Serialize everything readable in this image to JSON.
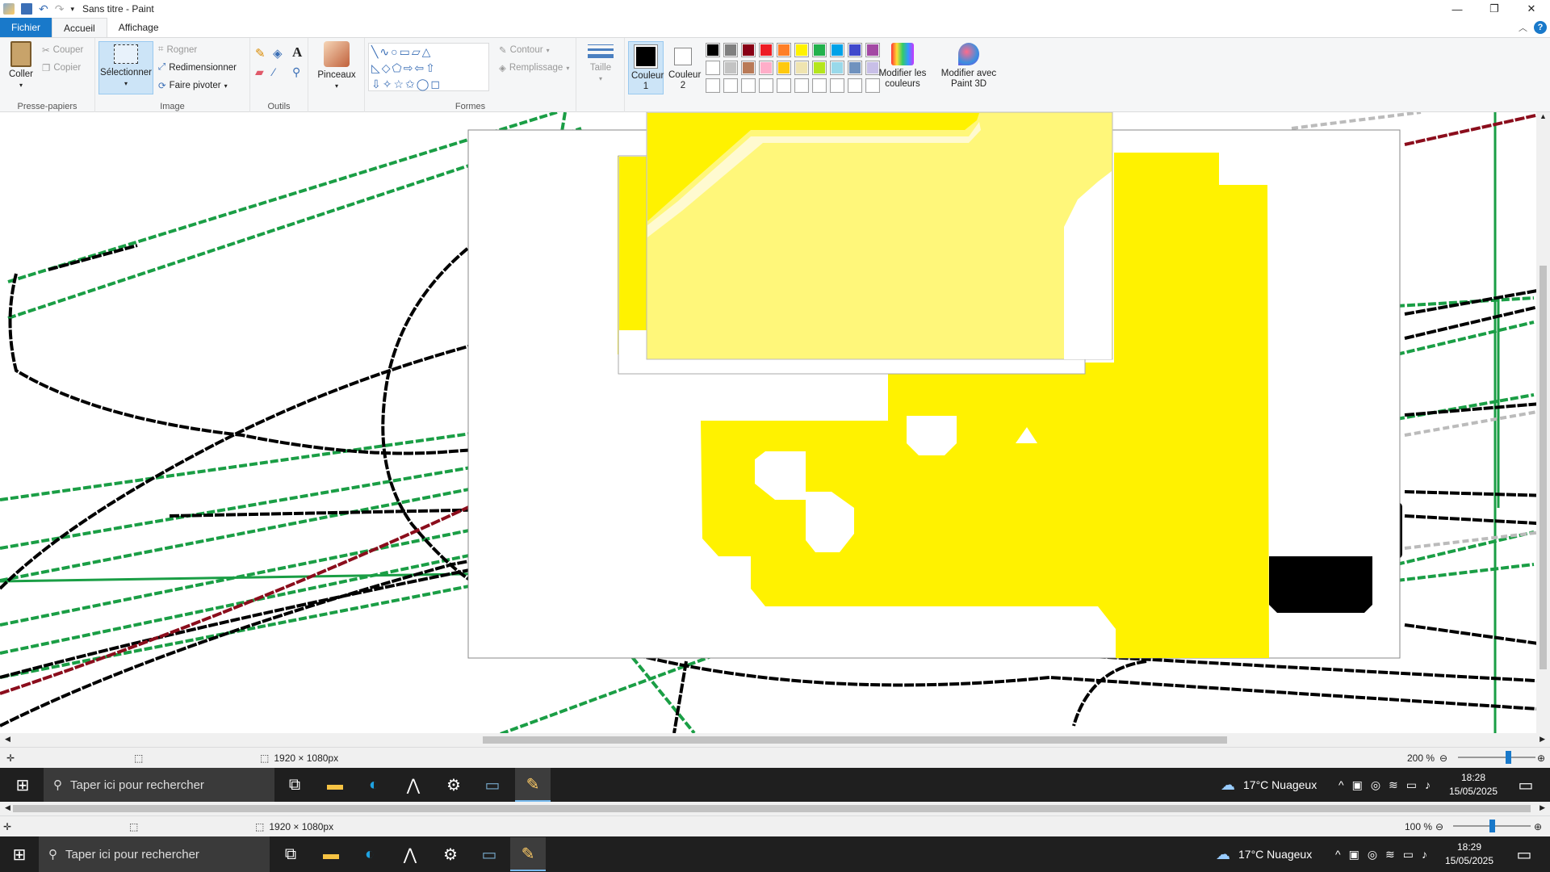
{
  "window": {
    "title": "Sans titre - Paint"
  },
  "tabs": {
    "file": "Fichier",
    "home": "Accueil",
    "view": "Affichage"
  },
  "clipboard": {
    "paste": "Coller",
    "cut": "Couper",
    "copy": "Copier",
    "label": "Presse-papiers"
  },
  "image": {
    "select": "Sélectionner",
    "crop": "Rogner",
    "resize": "Redimensionner",
    "rotate": "Faire pivoter",
    "label": "Image"
  },
  "tools": {
    "label": "Outils"
  },
  "brushes": {
    "label": "Pinceaux"
  },
  "shapes": {
    "outline": "Contour",
    "fill": "Remplissage",
    "label": "Formes"
  },
  "size": {
    "label": "Taille"
  },
  "colors": {
    "color1": "Couleur 1",
    "color2": "Couleur 2",
    "edit": "Modifier les couleurs",
    "paint3d": "Modifier avec Paint 3D",
    "color1_value": "#000000",
    "color2_value": "#ffffff",
    "palette_row1": [
      "#000000",
      "#7f7f7f",
      "#880015",
      "#ed1c24",
      "#ff7f27",
      "#fff200",
      "#22b14c",
      "#00a2e8",
      "#3f48cc",
      "#a349a4"
    ],
    "palette_row2": [
      "#ffffff",
      "#c3c3c3",
      "#b97a57",
      "#ffaec9",
      "#ffc90e",
      "#efe4b0",
      "#b5e61d",
      "#99d9ea",
      "#7092be",
      "#c8bfe7"
    ]
  },
  "status_inner": {
    "dimensions": "1920 × 1080px",
    "zoom": "200 %",
    "zoom_fraction": 0.66
  },
  "taskbar_inner": {
    "search": "Taper ici pour rechercher",
    "weather": "17°C  Nuageux",
    "time": "18:28",
    "date": "15/05/2025"
  },
  "status_outer": {
    "dimensions": "1920 × 1080px",
    "zoom": "100 %",
    "zoom_fraction": 0.5
  },
  "taskbar_outer": {
    "search": "Taper ici pour rechercher",
    "weather": "17°C  Nuageux",
    "time": "18:29",
    "date": "15/05/2025"
  }
}
